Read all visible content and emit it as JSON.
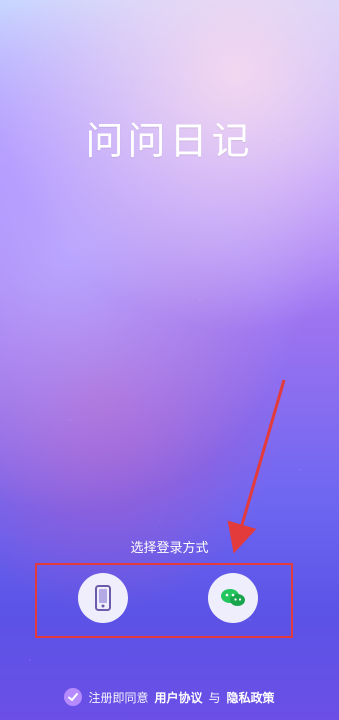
{
  "app": {
    "title": "问问日记"
  },
  "login": {
    "choose_label": "选择登录方式",
    "options": [
      {
        "name": "phone",
        "icon": "phone-icon"
      },
      {
        "name": "wechat",
        "icon": "wechat-icon"
      }
    ]
  },
  "agreement": {
    "prefix": "注册即同意",
    "terms": "用户协议",
    "conjunction": "与",
    "privacy": "隐私政策"
  },
  "colors": {
    "highlight_box": "#e33b3b",
    "arrow": "#e33b3b",
    "wechat_green": "#22c55e"
  }
}
